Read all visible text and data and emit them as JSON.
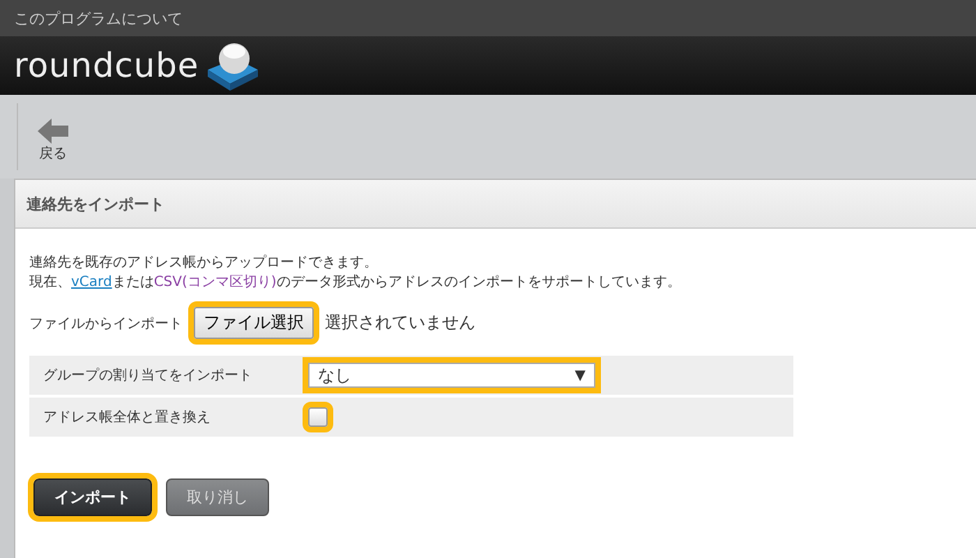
{
  "top_bar": {
    "link": "このプログラムについて"
  },
  "header": {
    "logo_text": "roundcube"
  },
  "toolbar": {
    "buttons": [
      {
        "label": "戻る",
        "kind": "back"
      }
    ]
  },
  "panel": {
    "title": "連絡先をインポート",
    "intro": [
      "連絡先を既存のアドレス帳からアップロードできます。"
    ],
    "formats": [
      {
        "text": "現在、",
        "kind": "plain"
      },
      {
        "text": "vCard",
        "kind": "link"
      },
      {
        "text": "または",
        "kind": "plain"
      },
      {
        "text": "CSV(コンマ区切り)",
        "kind": "accent"
      },
      {
        "text": "のデータ形式からアドレスのインポートをサポートしています。",
        "kind": "plain"
      }
    ],
    "file": {
      "label": "ファイルからインポート",
      "button": "ファイル選択",
      "status": "選択されていません",
      "highlighted": true
    },
    "options": [
      {
        "kind": "select",
        "label": "グループの割り当てをインポート",
        "value": "なし",
        "arrow": "▼",
        "highlighted": true
      },
      {
        "kind": "checkbox",
        "label": "アドレス帳全体と置き換え",
        "checked": false,
        "highlighted": true
      }
    ],
    "buttons": [
      {
        "label": "インポート",
        "kind": "primary",
        "highlighted": true
      },
      {
        "label": "取り消し",
        "kind": "secondary",
        "highlighted": false
      }
    ]
  }
}
